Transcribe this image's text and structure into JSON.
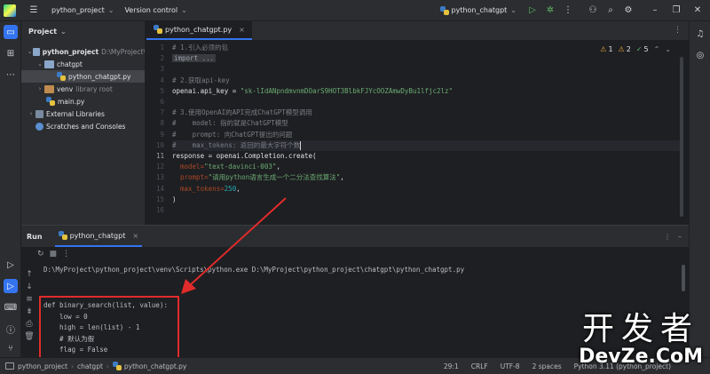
{
  "titlebar": {
    "project_name": "python_project",
    "vcs_label": "Version control",
    "run_config": "python_chatgpt"
  },
  "project_panel": {
    "title": "Project",
    "tree": [
      {
        "label": "python_project",
        "hint": "D:\\MyProject\\"
      },
      {
        "label": "chatgpt",
        "hint": ""
      },
      {
        "label": "python_chatgpt.py",
        "hint": ""
      },
      {
        "label": "venv",
        "hint": "library root"
      },
      {
        "label": "main.py",
        "hint": ""
      },
      {
        "label": "External Libraries",
        "hint": ""
      },
      {
        "label": "Scratches and Consoles",
        "hint": ""
      }
    ]
  },
  "editor": {
    "tab_label": "python_chatgpt.py",
    "inspections": {
      "warnings": "1",
      "weak": "2",
      "typos": "5"
    },
    "line_numbers": [
      "1",
      "2",
      "3",
      "4",
      "5",
      "6",
      "7",
      "8",
      "9",
      "10",
      "11",
      "12",
      "13",
      "14",
      "15",
      "16"
    ],
    "lines": {
      "l1": "# 1.引入必须的包",
      "l2": "import ...",
      "l4": "# 2.获取api-key",
      "l5a": "openai.api_key = ",
      "l5b": "\"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\"",
      "l7": "# 3.使用OpenAI的API完成ChatGPT模型调用",
      "l8": "#    model: 指的就是ChatGPT模型",
      "l9": "#    prompt: 向ChatGPT提出的问题",
      "l10": "#    max_tokens: 返回的最大字符个数",
      "l11": "response = openai.Completion.create(",
      "l12a": "model=",
      "l12b": "\"text-davinci-003\"",
      "l12c": ",",
      "l13a": "prompt=",
      "l13b": "\"请用python语言生成一个二分法查找算法\"",
      "l13c": ",",
      "l14a": "max_tokens=",
      "l14b": "250",
      "l14c": ",",
      "l15": ")"
    }
  },
  "run_panel": {
    "title": "Run",
    "tab_label": "python_chatgpt",
    "output": [
      "D:\\MyProject\\python_project\\venv\\Scripts\\python.exe D:\\MyProject\\python_project\\chatgpt\\python_chatgpt.py",
      "",
      "",
      "def binary_search(list, value):",
      "    low = 0",
      "    high = len(list) - 1",
      "    # 默认为假",
      "    flag = False"
    ]
  },
  "statusbar": {
    "breadcrumb": [
      "python_project",
      "chatgpt",
      "python_chatgpt.py"
    ],
    "position": "29:1",
    "line_sep": "CRLF",
    "encoding": "UTF-8",
    "indent": "2 spaces",
    "interpreter": "Python 3.11 (python_project)"
  },
  "watermark": {
    "line1": "开发者",
    "line2": "DevZe.CoM"
  },
  "colors": {
    "accent": "#3574f0",
    "highlight_box": "#e02b2b"
  }
}
